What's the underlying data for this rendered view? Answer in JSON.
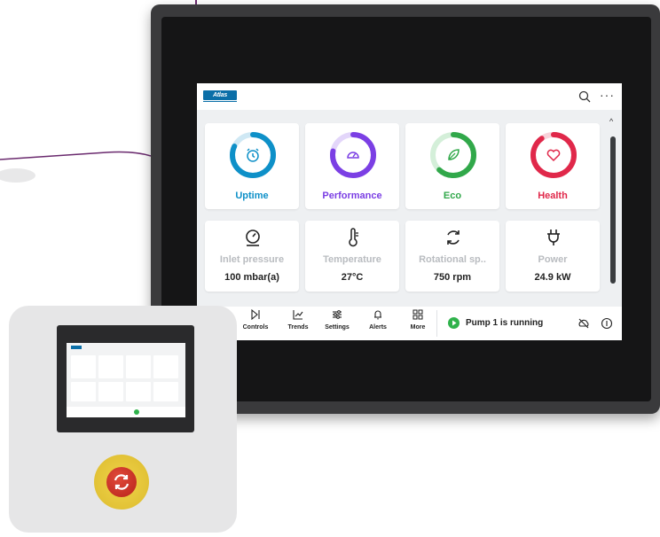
{
  "brand": {
    "logo_text": "Atlas Copco",
    "accent": "#0b6fa8"
  },
  "topbar": {
    "search_icon": "search-icon",
    "more_label": "···"
  },
  "kpis": [
    {
      "label": "Uptime",
      "color": "#0e90c8",
      "track": "#cfe8f4",
      "icon": "clock-icon",
      "level": 0.82
    },
    {
      "label": "Performance",
      "color": "#7b3fe4",
      "track": "#e3d6fa",
      "icon": "gauge-icon",
      "level": 0.78
    },
    {
      "label": "Eco",
      "color": "#31a84a",
      "track": "#d4efd9",
      "icon": "leaf-icon",
      "level": 0.62
    },
    {
      "label": "Health",
      "color": "#e0284a",
      "track": "#f8d2da",
      "icon": "heart-icon",
      "level": 0.9
    }
  ],
  "measurements": [
    {
      "label": "Inlet pressure",
      "value": "100 mbar(a)",
      "icon": "pressure-gauge-icon"
    },
    {
      "label": "Temperature",
      "value": "27°C",
      "icon": "thermometer-icon"
    },
    {
      "label": "Rotational sp..",
      "value": "750 rpm",
      "icon": "rotation-icon"
    },
    {
      "label": "Power",
      "value": "24.9 kW",
      "icon": "plug-icon"
    }
  ],
  "nav": [
    {
      "label": "Controls",
      "icon": "play-pause-icon"
    },
    {
      "label": "Trends",
      "icon": "chart-icon"
    },
    {
      "label": "Settings",
      "icon": "sliders-icon"
    },
    {
      "label": "Alerts",
      "icon": "bell-icon"
    },
    {
      "label": "More",
      "icon": "grid-icon"
    }
  ],
  "status": {
    "text": "Pump 1 is running",
    "color": "#2fb24b"
  }
}
